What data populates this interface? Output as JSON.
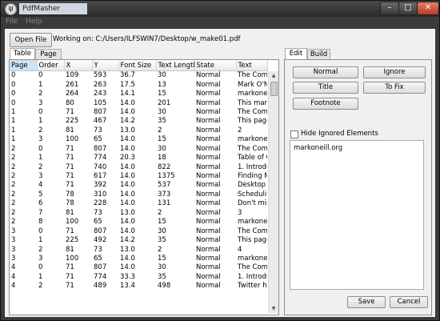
{
  "window": {
    "title": "PdfMasher",
    "controls": {
      "min": "–",
      "max": "□",
      "close": "✕"
    }
  },
  "menu": [
    "File",
    "Help"
  ],
  "toolbar": {
    "open_label": "Open File",
    "working_on": "Working on: C:/Users/ILFSWIN7/Desktop/w_make01.pdf"
  },
  "left_tabs": [
    "Table",
    "Page"
  ],
  "table": {
    "columns": [
      "Page",
      "Order",
      "X",
      "Y",
      "Font Size",
      "Text Length",
      "State",
      "Text"
    ],
    "rows": [
      [
        "0",
        "0",
        "109",
        "593",
        "36.7",
        "30",
        "Normal",
        "The Compl"
      ],
      [
        "0",
        "1",
        "261",
        "263",
        "17.5",
        "13",
        "Normal",
        "Mark O'Ne"
      ],
      [
        "0",
        "2",
        "264",
        "243",
        "14.1",
        "15",
        "Normal",
        "markoneill."
      ],
      [
        "0",
        "3",
        "80",
        "105",
        "14.0",
        "201",
        "Normal",
        "This manua"
      ],
      [
        "1",
        "0",
        "71",
        "807",
        "14.0",
        "30",
        "Normal",
        "The Compl"
      ],
      [
        "1",
        "1",
        "225",
        "467",
        "14.2",
        "35",
        "Normal",
        "This page i"
      ],
      [
        "1",
        "2",
        "81",
        "73",
        "13.0",
        "2",
        "Normal",
        "2"
      ],
      [
        "1",
        "3",
        "100",
        "65",
        "14.0",
        "15",
        "Normal",
        "markoneill."
      ],
      [
        "2",
        "0",
        "71",
        "807",
        "14.0",
        "30",
        "Normal",
        "The Compl"
      ],
      [
        "2",
        "1",
        "71",
        "774",
        "20.3",
        "18",
        "Normal",
        "Table of Co"
      ],
      [
        "2",
        "2",
        "71",
        "740",
        "14.0",
        "822",
        "Normal",
        "1. Introduc"
      ],
      [
        "2",
        "3",
        "71",
        "617",
        "14.0",
        "1375",
        "Normal",
        "Finding Mo"
      ],
      [
        "2",
        "4",
        "71",
        "392",
        "14.0",
        "537",
        "Normal",
        " Desktop A"
      ],
      [
        "2",
        "5",
        "78",
        "310",
        "14.0",
        "373",
        "Normal",
        "Scheduling"
      ],
      [
        "2",
        "6",
        "78",
        "228",
        "14.0",
        "131",
        "Normal",
        "Don't miss"
      ],
      [
        "2",
        "7",
        "81",
        "73",
        "13.0",
        "2",
        "Normal",
        "3"
      ],
      [
        "2",
        "8",
        "100",
        "65",
        "14.0",
        "15",
        "Normal",
        "markoneill."
      ],
      [
        "3",
        "0",
        "71",
        "807",
        "14.0",
        "30",
        "Normal",
        "The Compl"
      ],
      [
        "3",
        "1",
        "225",
        "492",
        "14.2",
        "35",
        "Normal",
        "This page i"
      ],
      [
        "3",
        "2",
        "81",
        "73",
        "13.0",
        "2",
        "Normal",
        "4"
      ],
      [
        "3",
        "3",
        "100",
        "65",
        "14.0",
        "15",
        "Normal",
        "markoneill."
      ],
      [
        "4",
        "0",
        "71",
        "807",
        "14.0",
        "30",
        "Normal",
        "The Compl"
      ],
      [
        "4",
        "1",
        "71",
        "774",
        "33.3",
        "35",
        "Normal",
        "1. Introduc"
      ],
      [
        "4",
        "2",
        "71",
        "489",
        "13.4",
        "498",
        "Normal",
        "Twitter has"
      ]
    ]
  },
  "right_tabs": [
    "Edit",
    "Build"
  ],
  "edit": {
    "normal_label": "Normal",
    "ignore_label": "Ignore",
    "title_label": "Title",
    "tofix_label": "To Fix",
    "footnote_label": "Footnote",
    "hide_ignored_label": "Hide Ignored Elements",
    "hide_ignored_checked": false,
    "text_content": "markoneill.org",
    "save_label": "Save",
    "cancel_label": "Cancel"
  }
}
